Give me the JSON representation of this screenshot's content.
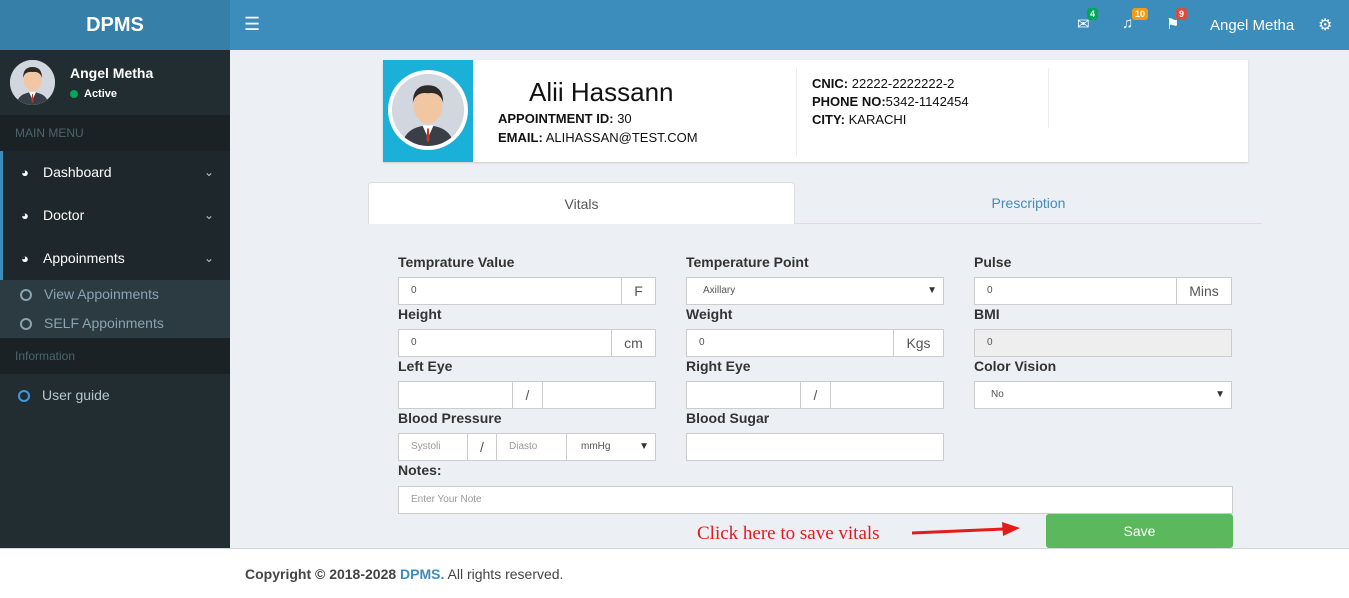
{
  "app": {
    "logo": "DPMS"
  },
  "sidebar": {
    "user_name": "Angel Metha",
    "status": "Active",
    "main_menu_header": "MAIN MENU",
    "items": [
      {
        "label": "Dashboard"
      },
      {
        "label": "Doctor"
      },
      {
        "label": "Appoinments"
      }
    ],
    "sub_items": [
      {
        "label": "View Appoinments"
      },
      {
        "label": "SELF Appoinments"
      }
    ],
    "info_header": "Information",
    "guide": "User guide"
  },
  "topbar": {
    "user_name": "Angel Metha",
    "badges": {
      "mail": "4",
      "bell": "10",
      "flag": "9"
    },
    "colors": {
      "mail": "#00a65a",
      "bell": "#f39c12",
      "flag": "#dd4b39"
    }
  },
  "patient": {
    "name": "Alii Hassann",
    "appointment_label": "APPOINTMENT ID:",
    "appointment_id": "30",
    "email_label": "EMAIL:",
    "email": "ALIHASSAN@TEST.COM",
    "cnic_label": "CNIC:",
    "cnic": "22222-2222222-2",
    "phone_label": "PHONE NO:",
    "phone": "5342-1142454",
    "city_label": "CITY:",
    "city": "KARACHI"
  },
  "tabs": {
    "vitals": "Vitals",
    "prescription": "Prescription"
  },
  "form": {
    "temp_value_label": "Temprature Value",
    "temp_value": "0",
    "temp_unit": "F",
    "temp_point_label": "Temperature Point",
    "temp_point": "Axillary",
    "pulse_label": "Pulse",
    "pulse": "0",
    "pulse_unit": "Mins",
    "height_label": "Height",
    "height": "0",
    "height_unit": "cm",
    "weight_label": "Weight",
    "weight": "0",
    "weight_unit": "Kgs",
    "bmi_label": "BMI",
    "bmi": "0",
    "left_eye_label": "Left Eye",
    "right_eye_label": "Right Eye",
    "slash": "/",
    "color_vision_label": "Color Vision",
    "color_vision": "No",
    "bp_label": "Blood Pressure",
    "bp_systolic_ph": "Systoli",
    "bp_diastolic_ph": "Diasto",
    "bp_unit": "mmHg",
    "sugar_label": "Blood Sugar",
    "notes_label": "Notes:",
    "notes_ph": "Enter Your Note",
    "save": "Save",
    "hint": "Click here to save  vitals"
  },
  "footer": {
    "prefix": "Copyright © 2018-2028",
    "brand": "DPMS.",
    "suffix": "All rights reserved."
  }
}
